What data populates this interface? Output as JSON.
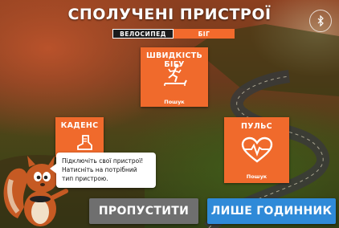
{
  "header": {
    "title": "СПОЛУЧЕНІ ПРИСТРОЇ"
  },
  "tabs": [
    {
      "label": "ВЕЛОСИПЕД",
      "active": true
    },
    {
      "label": "БІГ",
      "active": false
    }
  ],
  "devices": {
    "speed": {
      "title": "ШВИДКІСТЬ БІГУ",
      "status": "Пошук",
      "icon": "treadmill-runner-icon"
    },
    "cadence": {
      "title": "КАДЕНС",
      "icon": "shoe-icon"
    },
    "heart_rate": {
      "title": "ПУЛЬС",
      "status": "Пошук",
      "icon": "heart-pulse-icon"
    }
  },
  "tip": {
    "lines": [
      "Підключіть свої пристрої!",
      "Натисніть на потрібний",
      "тип пристрою."
    ]
  },
  "buttons": {
    "skip": "ПРОПУСТИТИ",
    "watch_only": "ЛИШЕ ГОДИННИК"
  },
  "colors": {
    "accent": "#f06a2c",
    "watch_button": "#2f8ad8",
    "skip_button": "#6f6f6f"
  }
}
